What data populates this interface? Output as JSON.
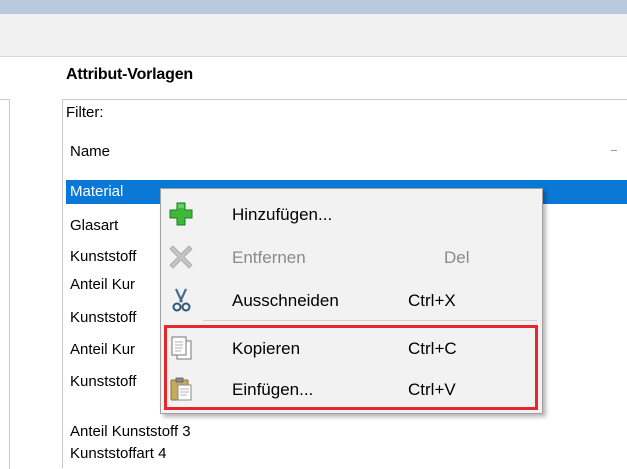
{
  "panel": {
    "title": "Attribut-Vorlagen",
    "filter_label": "Filter:",
    "column_header": "Name"
  },
  "list": {
    "rows": [
      "Material",
      "Glasart",
      "Kunststoff",
      "Anteil Kur",
      "Kunststoff",
      "Anteil Kur",
      "Kunststoff",
      "Anteil Kunststoff 3",
      "Kunststoffart 4"
    ],
    "selected_index": 0
  },
  "context_menu": {
    "items": [
      {
        "label": "Hinzufügen...",
        "shortcut": "",
        "icon": "plus-icon",
        "enabled": true
      },
      {
        "label": "Entfernen",
        "shortcut": "Del",
        "icon": "delete-x-icon",
        "enabled": false
      },
      {
        "label": "Ausschneiden",
        "shortcut": "Ctrl+X",
        "icon": "scissors-icon",
        "enabled": true
      },
      {
        "label": "Kopieren",
        "shortcut": "Ctrl+C",
        "icon": "copy-icon",
        "enabled": true
      },
      {
        "label": "Einfügen...",
        "shortcut": "Ctrl+V",
        "icon": "paste-icon",
        "enabled": true
      }
    ]
  },
  "colors": {
    "selection": "#0a78d7",
    "highlight_border": "#e8262e",
    "title_bar": "#b9c8dc"
  }
}
